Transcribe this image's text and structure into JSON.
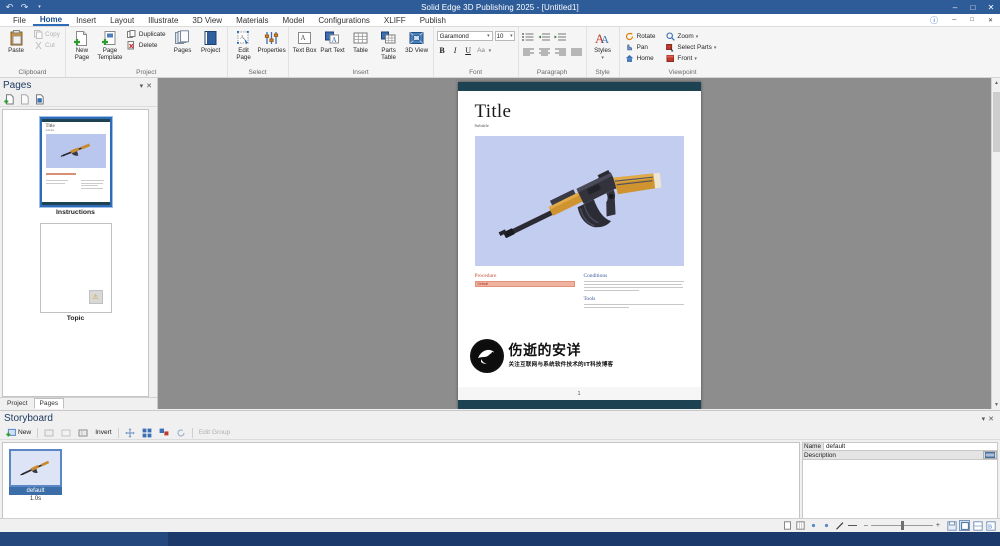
{
  "titlebar": {
    "title": "Solid Edge 3D Publishing  2025 - [Untitled1]",
    "quick_access": [
      "undo-icon",
      "redo-icon",
      "customize-icon"
    ],
    "controls": {
      "minimize": "–",
      "maximize": "□",
      "close": "✕"
    },
    "bg": "#2e5c99"
  },
  "menu": {
    "tabs": [
      {
        "label": "File",
        "active": false
      },
      {
        "label": "Home",
        "active": true
      },
      {
        "label": "Insert",
        "active": false
      },
      {
        "label": "Layout",
        "active": false
      },
      {
        "label": "Illustrate",
        "active": false
      },
      {
        "label": "3D View",
        "active": false
      },
      {
        "label": "Materials",
        "active": false
      },
      {
        "label": "Model",
        "active": false
      },
      {
        "label": "Configurations",
        "active": false
      },
      {
        "label": "XLIFF",
        "active": false
      },
      {
        "label": "Publish",
        "active": false
      }
    ],
    "help_icon": "help-icon",
    "window_icons": [
      "minimize-icon",
      "restore-icon",
      "close-icon"
    ]
  },
  "ribbon": {
    "groups": [
      {
        "name": "Clipboard",
        "buttons": [
          {
            "label": "Paste",
            "icon": "paste-icon",
            "enabled": true
          }
        ],
        "small_buttons": [
          {
            "label": "Copy",
            "icon": "copy-icon",
            "enabled": false
          },
          {
            "label": "Cut",
            "icon": "cut-icon",
            "enabled": false
          }
        ]
      },
      {
        "name": "Project",
        "buttons": [
          {
            "label": "New Page",
            "icon": "new-page-icon",
            "enabled": true
          },
          {
            "label": "Page Template",
            "icon": "page-template-icon",
            "enabled": true
          },
          {
            "label": "Pages",
            "icon": "pages-icon",
            "enabled": true
          },
          {
            "label": "Project",
            "icon": "project-icon",
            "enabled": true
          }
        ],
        "small_buttons": [
          {
            "label": "Duplicate",
            "icon": "duplicate-icon",
            "enabled": true
          },
          {
            "label": "Delete",
            "icon": "delete-icon",
            "enabled": true
          }
        ]
      },
      {
        "name": "Select",
        "buttons": [
          {
            "label": "Edit Page",
            "icon": "edit-page-icon",
            "enabled": true
          },
          {
            "label": "Properties",
            "icon": "properties-icon",
            "enabled": true
          }
        ]
      },
      {
        "name": "Insert",
        "buttons": [
          {
            "label": "Text Box",
            "icon": "text-box-icon",
            "enabled": true
          },
          {
            "label": "Part Text",
            "icon": "part-text-icon",
            "enabled": true
          },
          {
            "label": "Table",
            "icon": "table-icon",
            "enabled": true
          },
          {
            "label": "Parts Table",
            "icon": "parts-table-icon",
            "enabled": true
          },
          {
            "label": "3D View",
            "icon": "3d-view-icon",
            "enabled": true
          }
        ]
      },
      {
        "name": "Font",
        "font_family": "Garamond",
        "font_size": "10",
        "style_buttons": [
          {
            "label": "B",
            "name": "bold-button"
          },
          {
            "label": "I",
            "name": "italic-button"
          },
          {
            "label": "U",
            "name": "underline-button"
          },
          {
            "label": "Aa",
            "name": "change-case-button"
          }
        ]
      },
      {
        "name": "Paragraph",
        "icons": [
          "bullets-icon",
          "decrease-indent-icon",
          "increase-indent-icon",
          "align-left-icon",
          "align-center-icon",
          "align-right-icon",
          "justify-icon"
        ]
      },
      {
        "name": "Style",
        "buttons": [
          {
            "label": "Styles",
            "icon": "styles-icon",
            "enabled": true
          }
        ]
      },
      {
        "name": "Viewpoint",
        "small_buttons": [
          {
            "label": "Rotate",
            "icon": "rotate-icon",
            "enabled": true
          },
          {
            "label": "Zoom",
            "icon": "zoom-icon",
            "enabled": true,
            "dropdown": true
          },
          {
            "label": "Pan",
            "icon": "pan-icon",
            "enabled": true
          },
          {
            "label": "Select Parts",
            "icon": "select-parts-icon",
            "enabled": true,
            "dropdown": true
          },
          {
            "label": "Home",
            "icon": "home-icon",
            "enabled": true
          },
          {
            "label": "Front",
            "icon": "front-view-icon",
            "enabled": true,
            "dropdown": true
          }
        ]
      }
    ]
  },
  "pages_panel": {
    "title": "Pages",
    "tools": [
      "add-page-icon",
      "copy-page-icon",
      "paste-page-icon"
    ],
    "thumbnails": [
      {
        "label": "Instructions",
        "selected": true
      },
      {
        "label": "Topic",
        "selected": false
      }
    ],
    "tabs": [
      {
        "label": "Project",
        "active": false
      },
      {
        "label": "Pages",
        "active": true
      }
    ]
  },
  "document": {
    "title": "Title",
    "subtitle": "Subtitle",
    "page_number": "1",
    "image_bg": "#c3cdf0",
    "bar_color": "#1d4252",
    "sections": [
      {
        "heading": "Procedure",
        "color": "#c0543a",
        "bar_text": "Default"
      },
      {
        "heading": "Conditions",
        "color": "#3a5ba0"
      },
      {
        "heading": "Tools",
        "color": "#3a5ba0"
      }
    ],
    "watermark": {
      "main": "伤逝的安详",
      "sub": "关注互联网与系统软件技术的IT科技博客",
      "logo_text": "伤逝的安详"
    }
  },
  "storyboard": {
    "title": "Storyboard",
    "toolbar": [
      {
        "label": "New",
        "icon": "new-frame-icon",
        "enabled": true
      },
      {
        "label": "",
        "icon": "capture-icon",
        "enabled": false
      },
      {
        "label": "",
        "icon": "update-icon",
        "enabled": false
      },
      {
        "label": "",
        "icon": "properties-frame-icon",
        "enabled": true
      },
      {
        "label": "Invert",
        "icon": "invert-icon",
        "enabled": true
      },
      {
        "label": "",
        "icon": "move-icon",
        "enabled": true
      },
      {
        "label": "",
        "icon": "grid-icon",
        "enabled": true
      },
      {
        "label": "",
        "icon": "group-icon",
        "enabled": true
      },
      {
        "label": "",
        "icon": "rotate-frame-icon",
        "enabled": true
      },
      {
        "label": "Edit Group",
        "icon": "edit-group-icon",
        "enabled": false
      }
    ],
    "frames": [
      {
        "name": "default",
        "time": "1.0s",
        "selected": true
      }
    ],
    "properties": {
      "name_label": "Name",
      "name_value": "default",
      "description_label": "Description",
      "description_value": ""
    }
  },
  "statusbar": {
    "icons": [
      "page-view-icon",
      "grid-view-icon",
      "point-icon",
      "point2-icon",
      "pen-icon",
      "line-icon"
    ],
    "zoom_minus": "–",
    "zoom_plus": "+",
    "right_icons": [
      "save-view-icon",
      "fit-view-icon",
      "preview-icon",
      "publish-icon"
    ]
  }
}
